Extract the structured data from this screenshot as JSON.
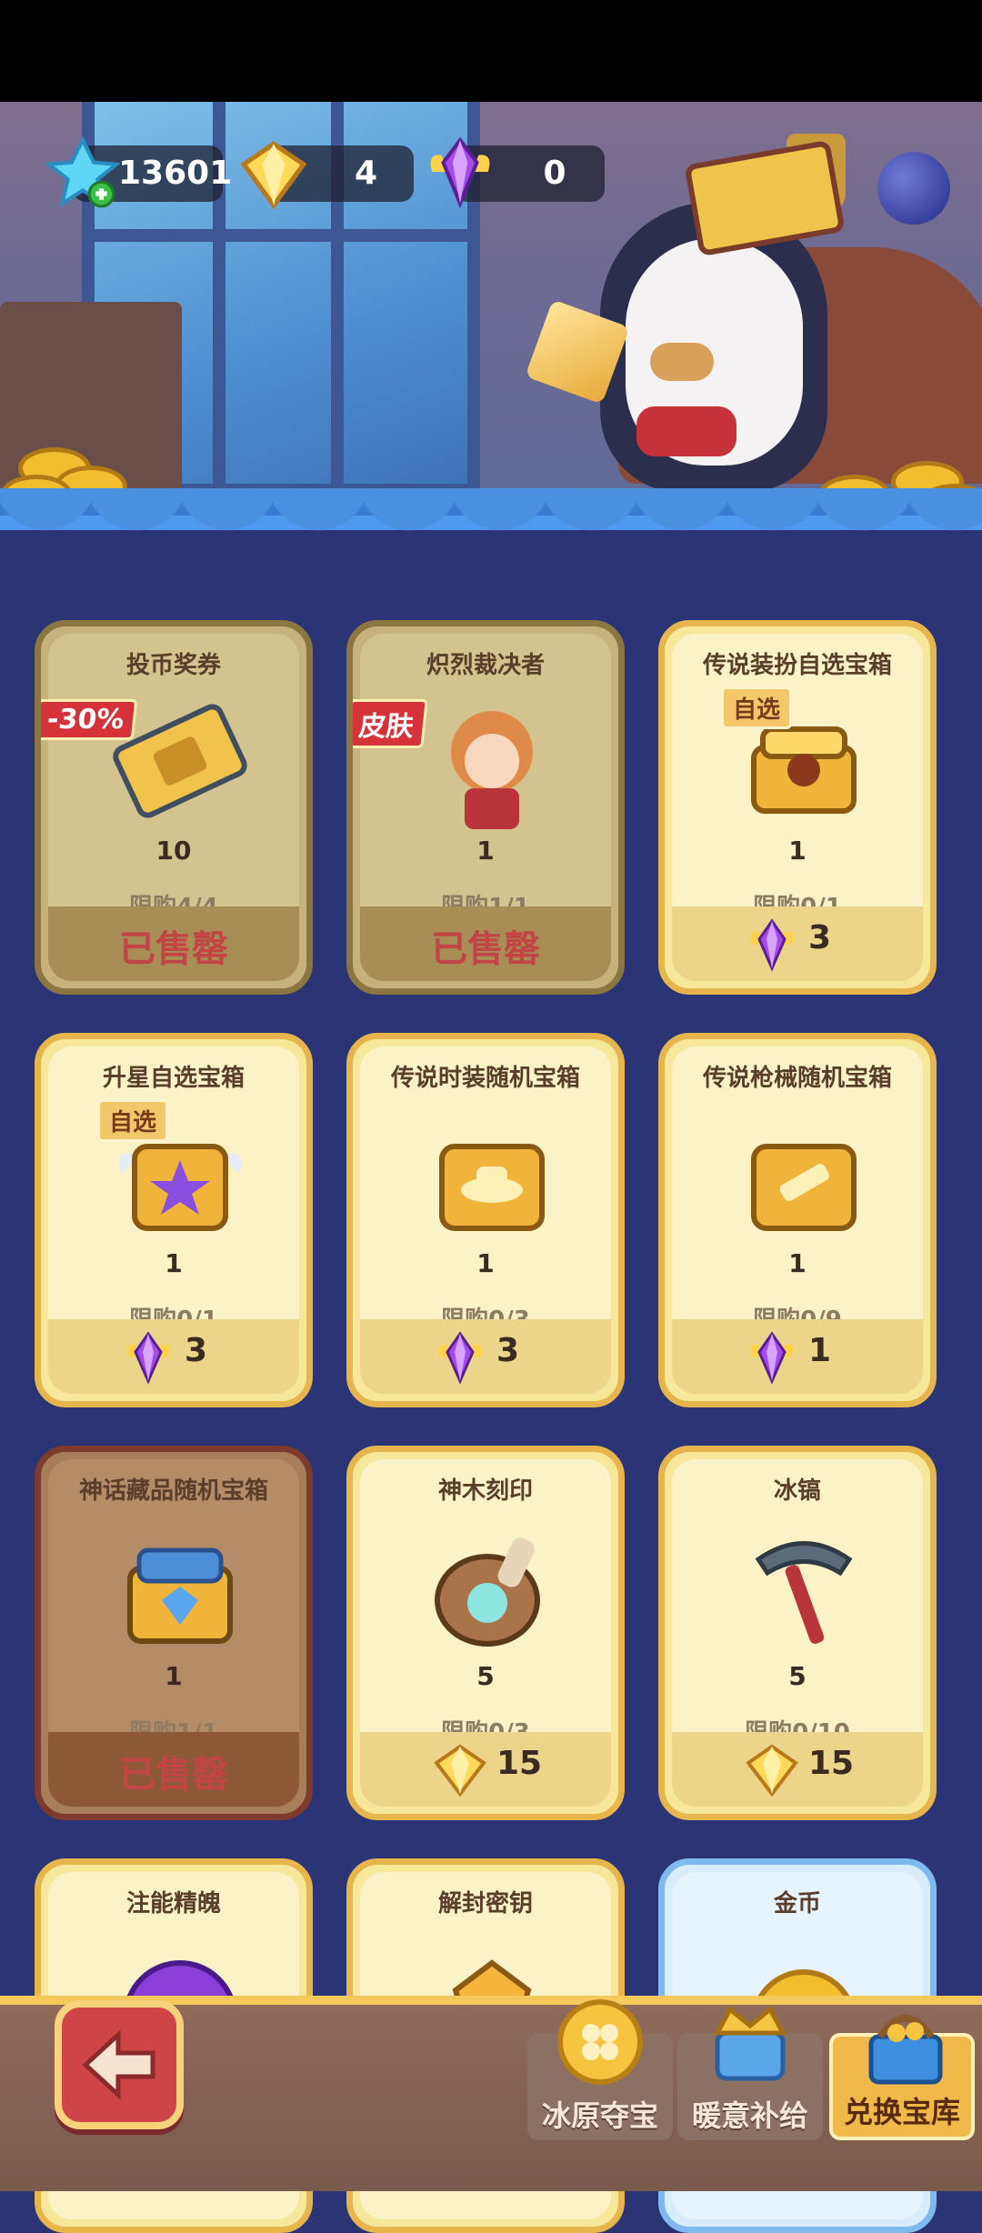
{
  "currencies": [
    {
      "name": "snowflake-crystal",
      "value": "13601"
    },
    {
      "name": "gold-gem",
      "value": "4"
    },
    {
      "name": "purple-gem",
      "value": "0"
    }
  ],
  "cards": [
    {
      "title": "投币奖券",
      "qty": "10",
      "limit": "限购4/4",
      "sold": "已售罄",
      "tag": "-30%",
      "icon": "ticket-icon",
      "status": "soldout"
    },
    {
      "title": "炽烈裁决者",
      "qty": "1",
      "limit": "限购1/1",
      "sold": "已售罄",
      "tag": "皮肤",
      "icon": "character-skin-icon",
      "status": "soldout"
    },
    {
      "title": "传说装扮自选宝箱",
      "qty": "1",
      "limit": "限购0/1",
      "price": "3",
      "pick": "自选",
      "icon": "chest-icon",
      "status": "available"
    },
    {
      "title": "升星自选宝箱",
      "qty": "1",
      "limit": "限购0/1",
      "price": "3",
      "pick": "自选",
      "icon": "star-chest-icon",
      "status": "available"
    },
    {
      "title": "传说时装随机宝箱",
      "qty": "1",
      "limit": "限购0/3",
      "price": "3",
      "icon": "hat-chest-icon",
      "status": "available"
    },
    {
      "title": "传说枪械随机宝箱",
      "qty": "1",
      "limit": "限购0/9",
      "price": "1",
      "icon": "gun-chest-icon",
      "status": "available"
    },
    {
      "title": "神话藏品随机宝箱",
      "qty": "1",
      "limit": "限购1/1",
      "sold": "已售罄",
      "icon": "myth-chest-icon",
      "status": "soldout-myth"
    },
    {
      "title": "神木刻印",
      "qty": "5",
      "limit": "限购0/3",
      "price": "15",
      "icon": "wood-seal-icon",
      "status": "available"
    },
    {
      "title": "冰镐",
      "qty": "5",
      "limit": "限购0/10",
      "price": "15",
      "icon": "ice-pickaxe-icon",
      "status": "available"
    },
    {
      "title": "注能精魄",
      "icon": "purple-orb-icon",
      "status": "available"
    },
    {
      "title": "解封密钥",
      "icon": "key-icon",
      "status": "available"
    },
    {
      "title": "金币",
      "icon": "gold-coin-icon",
      "status": "blue"
    }
  ],
  "nav": [
    {
      "label": "冰原夺宝",
      "icon": "clover-coin-icon"
    },
    {
      "label": "暖意补给",
      "icon": "crown-chest-icon"
    },
    {
      "label": "兑换宝库",
      "icon": "shopping-basket-icon",
      "active": true
    }
  ],
  "colors": {
    "gold": "#f2be2f",
    "soldout_red": "#c24545",
    "background": "#2b3576"
  }
}
